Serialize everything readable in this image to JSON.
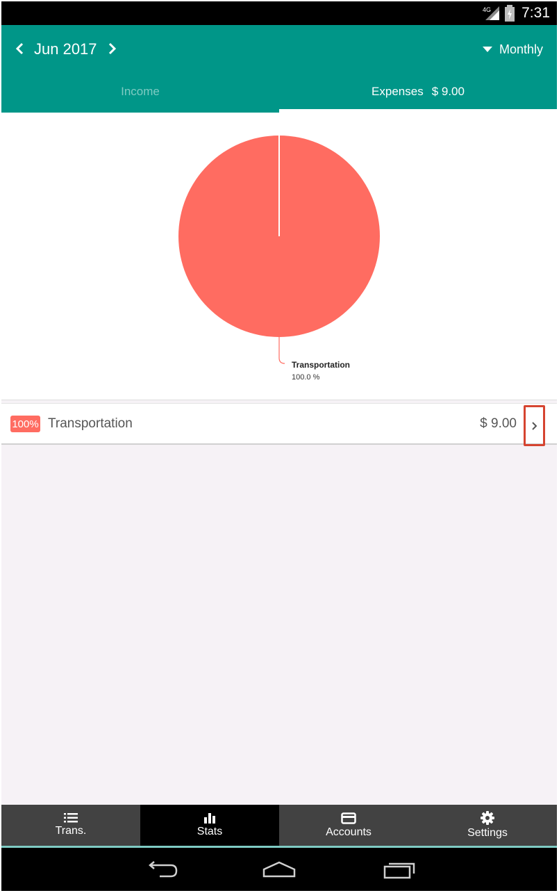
{
  "status_bar": {
    "network_label": "4G",
    "time": "7:31",
    "icons": [
      "signal-icon",
      "battery-icon"
    ]
  },
  "header": {
    "month": "Jun 2017",
    "period": "Monthly",
    "tabs": [
      {
        "label": "Income",
        "amount": "",
        "selected": false
      },
      {
        "label": "Expenses",
        "amount": "$ 9.00",
        "selected": true
      }
    ]
  },
  "chart_data": {
    "type": "pie",
    "slices": [
      {
        "label": "Transportation",
        "value": 100.0,
        "value_label": "100.0 %",
        "color": "#ff6c61"
      }
    ]
  },
  "categories": [
    {
      "percent": "100%",
      "name": "Transportation",
      "amount": "$ 9.00"
    }
  ],
  "bottom_nav": {
    "items": [
      {
        "label": "Trans.",
        "icon": "list-icon",
        "active": false
      },
      {
        "label": "Stats",
        "icon": "bar-chart-icon",
        "active": true
      },
      {
        "label": "Accounts",
        "icon": "card-icon",
        "active": false
      },
      {
        "label": "Settings",
        "icon": "gear-icon",
        "active": false
      }
    ]
  },
  "colors": {
    "primary": "#009688",
    "expense": "#ff6c61",
    "highlight_box": "#d64430",
    "inactive_tab": "#7fcbc3"
  }
}
